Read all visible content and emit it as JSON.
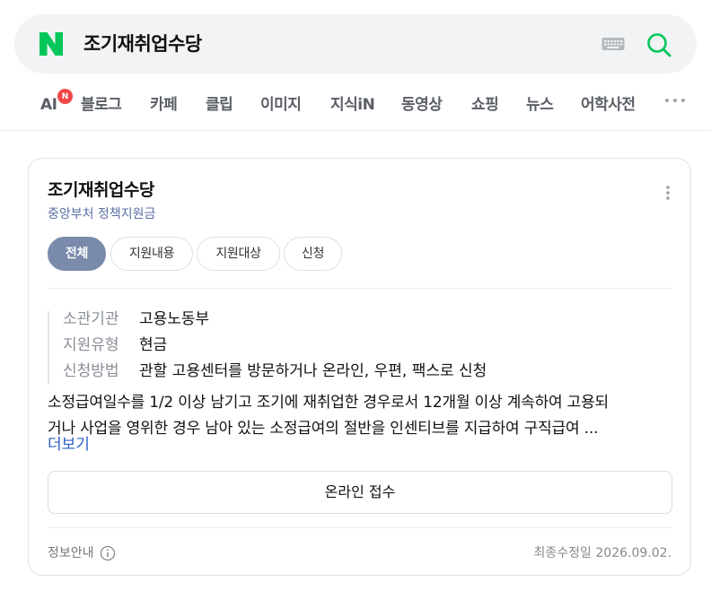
{
  "search": {
    "query": "조기재취업수당"
  },
  "tabs": {
    "ai": "AI",
    "ai_badge": "N",
    "items": [
      "블로그",
      "카페",
      "클립",
      "이미지",
      "지식iN",
      "동영상",
      "쇼핑",
      "뉴스",
      "어학사전"
    ]
  },
  "card": {
    "title": "조기재취업수당",
    "subtitle": "중앙부처 정책지원금",
    "chips": [
      "전체",
      "지원내용",
      "지원대상",
      "신청"
    ],
    "active_chip": "전체",
    "info": [
      {
        "label": "소관기관",
        "value": "고용노동부"
      },
      {
        "label": "지원유형",
        "value": "현금"
      },
      {
        "label": "신청방법",
        "value": "관할 고용센터를 방문하거나 온라인, 우편, 팩스로 신청"
      }
    ],
    "description_line1": "소정급여일수를 1/2 이상 남기고 조기에 재취업한 경우로서 12개월 이상 계속하여 고용되",
    "description_line2": "거나 사업을 영위한 경우 남아 있는 소정급여의 절반을 인센티브를 지급하여 구직급여 ...",
    "more_label": "더보기",
    "online_button": "온라인 접수",
    "footer_info": "정보안내",
    "footer_updated": "최종수정일 2026.09.02."
  },
  "colors": {
    "brand_green": "#03c75a",
    "active_chip": "#7a8aab",
    "link_blue": "#2b5fc0",
    "badge_red": "#f04646"
  }
}
